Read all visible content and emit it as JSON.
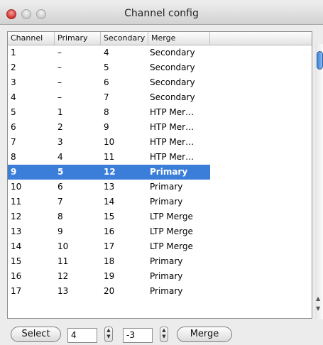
{
  "window": {
    "title": "Channel config"
  },
  "table": {
    "columns": [
      "Channel",
      "Primary",
      "Secondary",
      "Merge"
    ],
    "selected_row": 8,
    "rows": [
      [
        "1",
        "–",
        "4",
        "Secondary"
      ],
      [
        "2",
        "–",
        "5",
        "Secondary"
      ],
      [
        "3",
        "–",
        "6",
        "Secondary"
      ],
      [
        "4",
        "–",
        "7",
        "Secondary"
      ],
      [
        "5",
        "1",
        "8",
        "HTP Mer…"
      ],
      [
        "6",
        "2",
        "9",
        "HTP Mer…"
      ],
      [
        "7",
        "3",
        "10",
        "HTP Mer…"
      ],
      [
        "8",
        "4",
        "11",
        "HTP Mer…"
      ],
      [
        "9",
        "5",
        "12",
        "Primary"
      ],
      [
        "10",
        "6",
        "13",
        "Primary"
      ],
      [
        "11",
        "7",
        "14",
        "Primary"
      ],
      [
        "12",
        "8",
        "15",
        "LTP Merge"
      ],
      [
        "13",
        "9",
        "16",
        "LTP Merge"
      ],
      [
        "14",
        "10",
        "17",
        "LTP Merge"
      ],
      [
        "15",
        "11",
        "18",
        "Primary"
      ],
      [
        "16",
        "12",
        "19",
        "Primary"
      ],
      [
        "17",
        "13",
        "20",
        "Primary"
      ]
    ]
  },
  "controls": {
    "select_label": "Select",
    "field1_value": "4",
    "field2_value": "-3",
    "merge_label": "Merge"
  },
  "colors": {
    "selection": "#3b7ed9"
  }
}
